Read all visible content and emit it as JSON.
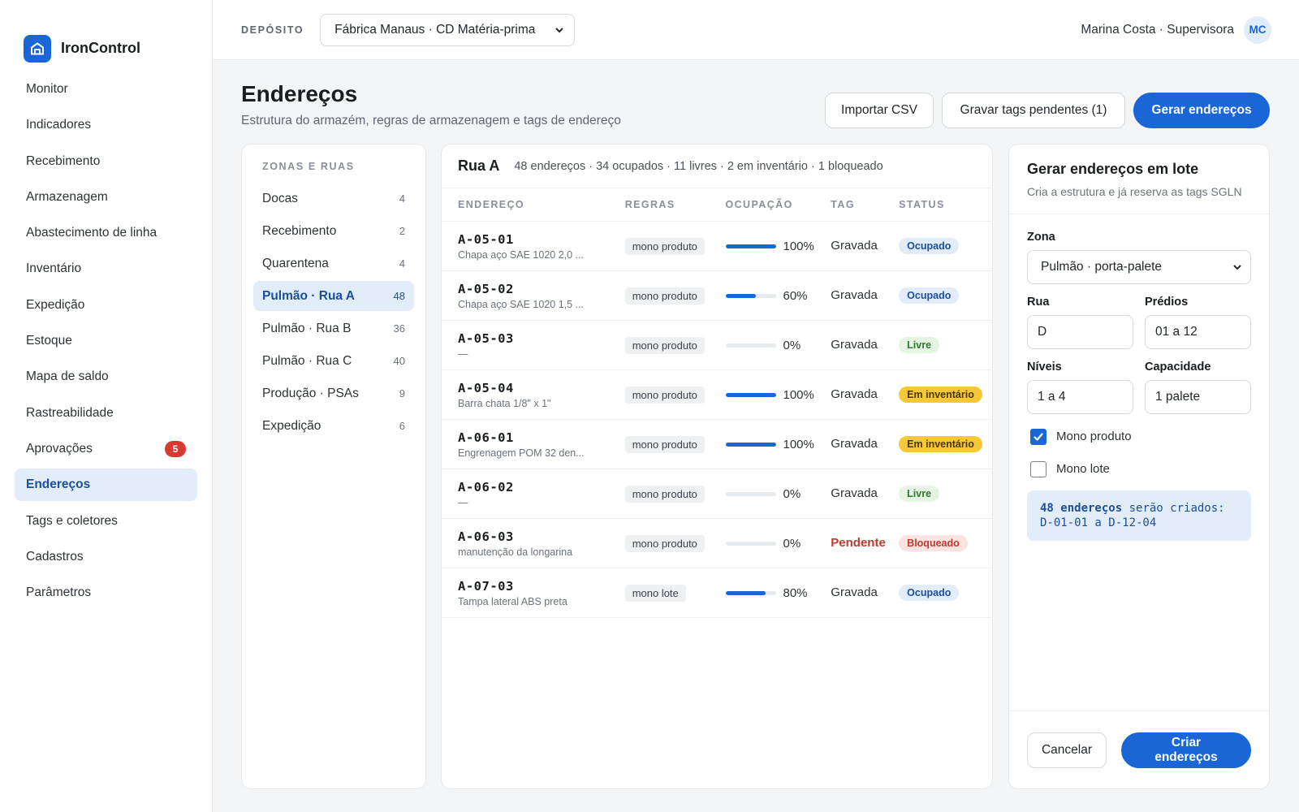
{
  "app": {
    "name": "IronControl"
  },
  "sidebar": {
    "items": [
      {
        "label": "Monitor"
      },
      {
        "label": "Indicadores"
      },
      {
        "label": "Recebimento"
      },
      {
        "label": "Armazenagem"
      },
      {
        "label": "Abastecimento de linha"
      },
      {
        "label": "Inventário"
      },
      {
        "label": "Expedição"
      },
      {
        "label": "Estoque"
      },
      {
        "label": "Mapa de saldo"
      },
      {
        "label": "Rastreabilidade"
      },
      {
        "label": "Aprovações",
        "badge": "5"
      },
      {
        "label": "Endereços",
        "active": true
      },
      {
        "label": "Tags e coletores"
      },
      {
        "label": "Cadastros"
      },
      {
        "label": "Parâmetros"
      }
    ]
  },
  "topbar": {
    "deposit_label": "DEPÓSITO",
    "deposit_value": "Fábrica Manaus · CD Matéria-prima",
    "user_name": "Marina Costa · Supervisora",
    "user_initials": "MC"
  },
  "header": {
    "title": "Endereços",
    "subtitle": "Estrutura do armazém, regras de armazenagem e tags de endereço",
    "import_label": "Importar CSV",
    "record_tags_label": "Gravar tags pendentes (1)",
    "generate_label": "Gerar endereços"
  },
  "zones": {
    "title": "ZONAS E RUAS",
    "items": [
      {
        "label": "Docas",
        "count": "4"
      },
      {
        "label": "Recebimento",
        "count": "2"
      },
      {
        "label": "Quarentena",
        "count": "4"
      },
      {
        "label": "Pulmão · Rua A",
        "count": "48",
        "active": true
      },
      {
        "label": "Pulmão · Rua B",
        "count": "36"
      },
      {
        "label": "Pulmão · Rua C",
        "count": "40"
      },
      {
        "label": "Produção · PSAs",
        "count": "9"
      },
      {
        "label": "Expedição",
        "count": "6"
      }
    ]
  },
  "table": {
    "title": "Rua A",
    "summary": "48 endereços · 34 ocupados · 11 livres · 2 em inventário · 1 bloqueado",
    "columns": [
      "ENDEREÇO",
      "REGRAS",
      "OCUPAÇÃO",
      "TAG",
      "STATUS"
    ],
    "rows": [
      {
        "address": "A-05-01",
        "item": "Chapa aço SAE 1020 2,0 ...",
        "rule": "mono produto",
        "occupancy": 100,
        "occupancy_label": "100%",
        "tag": "Gravada",
        "status": "Ocupado",
        "status_kind": "ocupado"
      },
      {
        "address": "A-05-02",
        "item": "Chapa aço SAE 1020 1,5 ...",
        "rule": "mono produto",
        "occupancy": 60,
        "occupancy_label": "60%",
        "tag": "Gravada",
        "status": "Ocupado",
        "status_kind": "ocupado"
      },
      {
        "address": "A-05-03",
        "item": "—",
        "rule": "mono produto",
        "occupancy": 0,
        "occupancy_label": "0%",
        "tag": "Gravada",
        "status": "Livre",
        "status_kind": "livre"
      },
      {
        "address": "A-05-04",
        "item": "Barra chata 1/8\" x 1\"",
        "rule": "mono produto",
        "occupancy": 100,
        "occupancy_label": "100%",
        "tag": "Gravada",
        "status": "Em inventário",
        "status_kind": "inv"
      },
      {
        "address": "A-06-01",
        "item": "Engrenagem POM 32 den...",
        "rule": "mono produto",
        "occupancy": 100,
        "occupancy_label": "100%",
        "tag": "Gravada",
        "status": "Em inventário",
        "status_kind": "inv"
      },
      {
        "address": "A-06-02",
        "item": "—",
        "rule": "mono produto",
        "occupancy": 0,
        "occupancy_label": "0%",
        "tag": "Gravada",
        "status": "Livre",
        "status_kind": "livre"
      },
      {
        "address": "A-06-03",
        "item": "manutenção da longarina",
        "rule": "mono produto",
        "occupancy": 0,
        "occupancy_label": "0%",
        "tag": "Pendente",
        "tag_pending": true,
        "status": "Bloqueado",
        "status_kind": "bloq"
      },
      {
        "address": "A-07-03",
        "item": "Tampa lateral ABS preta",
        "rule": "mono lote",
        "occupancy": 80,
        "occupancy_label": "80%",
        "tag": "Gravada",
        "status": "Ocupado",
        "status_kind": "ocupado"
      }
    ]
  },
  "form": {
    "title": "Gerar endereços em lote",
    "subtitle": "Cria a estrutura e já reserva as tags SGLN",
    "zone_label": "Zona",
    "zone_value": "Pulmão · porta-palete",
    "street_label": "Rua",
    "street_value": "D",
    "buildings_label": "Prédios",
    "buildings_value": "01 a 12",
    "levels_label": "Níveis",
    "levels_value": "1 a 4",
    "capacity_label": "Capacidade",
    "capacity_value": "1 palete",
    "mono_product_label": "Mono produto",
    "mono_product_checked": true,
    "mono_lot_label": "Mono lote",
    "mono_lot_checked": false,
    "info_bold": "48 endereços",
    "info_text": "serão criados: D-01-01 a D-12-04",
    "cancel_label": "Cancelar",
    "create_label": "Criar endereços"
  },
  "colors": {
    "accent": "#1a66d6",
    "danger": "#d83a32",
    "warning": "#f7c835"
  }
}
